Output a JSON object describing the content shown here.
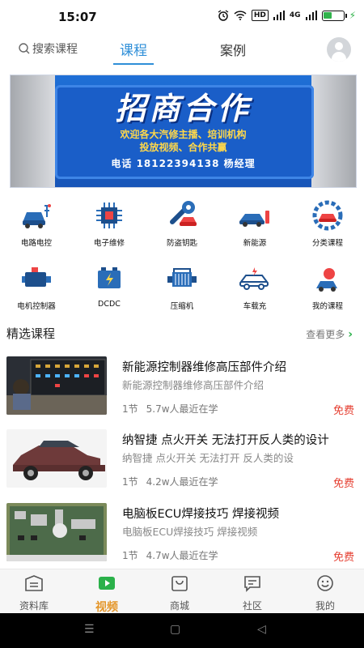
{
  "status_bar": {
    "time": "15:07",
    "hd": "HD",
    "signal_label": "4G"
  },
  "header": {
    "search_label": "搜索课程",
    "tabs": [
      {
        "label": "课程",
        "active": true
      },
      {
        "label": "案例",
        "active": false
      }
    ]
  },
  "banner": {
    "title": "招商合作",
    "line1": "欢迎各大汽修主播、培训机构",
    "line2": "投放视频、合作共赢",
    "phone": "电话 18122394138 杨经理"
  },
  "categories": [
    {
      "label": "电路电控",
      "icon": "car-circuit-icon"
    },
    {
      "label": "电子维修",
      "icon": "chip-icon"
    },
    {
      "label": "防盗钥匙",
      "icon": "car-key-icon"
    },
    {
      "label": "新能源",
      "icon": "ev-car-icon"
    },
    {
      "label": "分类课程",
      "icon": "gear-car-icon"
    },
    {
      "label": "电机控制器",
      "icon": "motor-icon"
    },
    {
      "label": "DCDC",
      "icon": "battery-icon"
    },
    {
      "label": "压缩机",
      "icon": "engine-icon"
    },
    {
      "label": "车载充",
      "icon": "charging-car-icon"
    },
    {
      "label": "我的课程",
      "icon": "my-course-icon"
    }
  ],
  "section": {
    "title": "精选课程",
    "more": "查看更多"
  },
  "courses": [
    {
      "title": "新能源控制器维修高压部件介绍",
      "subtitle": "新能源控制器维修高压部件介绍",
      "lessons": "1节",
      "learners": "5.7w人最近在学",
      "price": "免费"
    },
    {
      "title": "纳智捷 点火开关 无法打开反人类的设计",
      "subtitle": "纳智捷 点火开关 无法打开 反人类的设",
      "lessons": "1节",
      "learners": "4.2w人最近在学",
      "price": "免费"
    },
    {
      "title": "电脑板ECU焊接技巧  焊接视频",
      "subtitle": "电脑板ECU焊接技巧  焊接视频",
      "lessons": "1节",
      "learners": "4.7w人最近在学",
      "price": "免费"
    }
  ],
  "bottom_nav": [
    {
      "label": "资料库",
      "icon": "library-icon",
      "active": false
    },
    {
      "label": "视频",
      "icon": "video-icon",
      "active": true
    },
    {
      "label": "商城",
      "icon": "shop-icon",
      "active": false
    },
    {
      "label": "社区",
      "icon": "community-icon",
      "active": false
    },
    {
      "label": "我的",
      "icon": "profile-icon",
      "active": false
    }
  ],
  "colors": {
    "accent_blue": "#2f8fd8",
    "active_orange": "#e4962a",
    "price_red": "#e53e30",
    "more_green": "#2bb14a"
  }
}
